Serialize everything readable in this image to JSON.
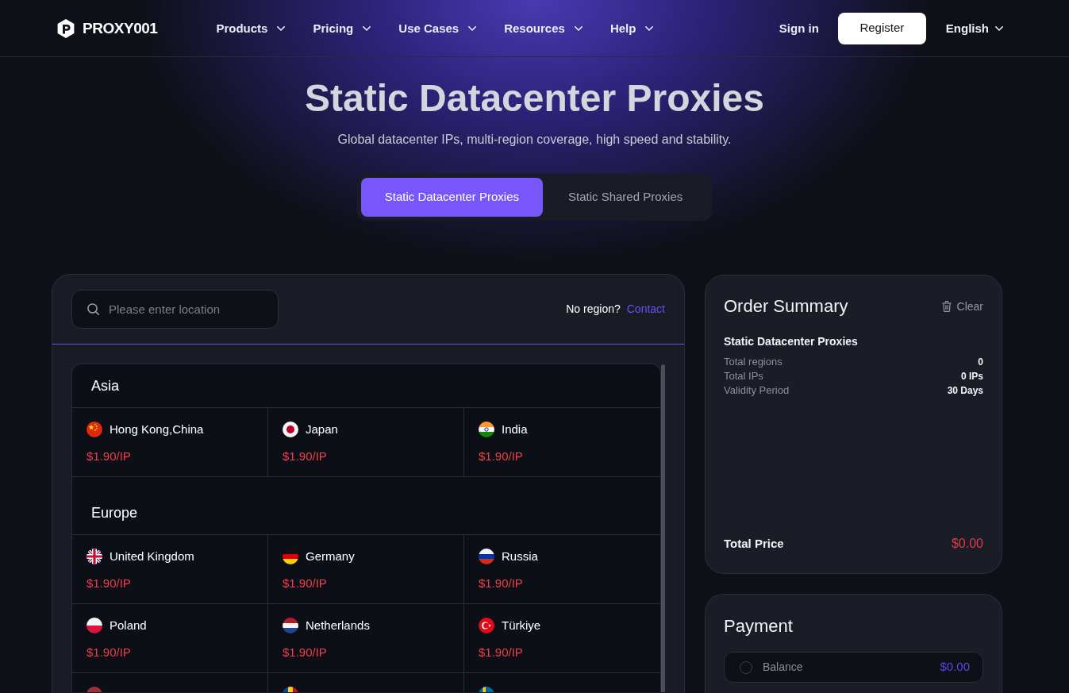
{
  "header": {
    "logo": "PROXY001",
    "nav": [
      {
        "label": "Products"
      },
      {
        "label": "Pricing"
      },
      {
        "label": "Use Cases"
      },
      {
        "label": "Resources"
      },
      {
        "label": "Help"
      }
    ],
    "sign_in": "Sign in",
    "register": "Register",
    "language": "English"
  },
  "hero": {
    "title": "Static Datacenter Proxies",
    "subtitle": "Global datacenter IPs, multi-region coverage, high speed and stability.",
    "tabs": [
      {
        "label": "Static Datacenter Proxies",
        "selected": true
      },
      {
        "label": "Static Shared Proxies",
        "selected": false
      }
    ]
  },
  "locations": {
    "search": {
      "placeholder": "Please enter location"
    },
    "no_region": "No region?",
    "contact": "Contact",
    "regions": [
      {
        "name": "Asia",
        "countries": [
          {
            "name": "Hong Kong,China",
            "kind": "china",
            "price": "$1.90/IP",
            "selected": false
          },
          {
            "name": "Japan",
            "kind": "japan",
            "price": "$1.90/IP",
            "selected": false
          },
          {
            "name": "India",
            "kind": "india",
            "price": "$1.90/IP",
            "selected": false
          }
        ]
      },
      {
        "name": "Europe",
        "countries": [
          {
            "name": "United Kingdom",
            "kind": "uk",
            "price": "$1.90/IP",
            "selected": false
          },
          {
            "name": "Germany",
            "kind": "germany",
            "price": "$1.90/IP",
            "selected": false
          },
          {
            "name": "Russia",
            "kind": "russia",
            "price": "$1.90/IP",
            "selected": false
          },
          {
            "name": "Poland",
            "kind": "poland",
            "price": "$1.90/IP",
            "selected": false
          },
          {
            "name": "Netherlands",
            "kind": "netherlands",
            "price": "$1.90/IP",
            "selected": false
          },
          {
            "name": "Türkiye",
            "kind": "turkey",
            "price": "$1.90/IP",
            "selected": false
          },
          {
            "kind": "latvia",
            "selected": false
          },
          {
            "kind": "moldova",
            "selected": false
          },
          {
            "kind": "sweden",
            "selected": false
          }
        ]
      }
    ]
  },
  "order_summary": {
    "title": "Order Summary",
    "clear": "Clear",
    "product": "Static Datacenter Proxies",
    "rows": [
      {
        "label": "Total regions",
        "value": "0"
      },
      {
        "label": "Total IPs",
        "value": "0 IPs"
      },
      {
        "label": "Validity Period",
        "value": "30 Days"
      }
    ],
    "total_label": "Total Price",
    "total_value": "$0.00"
  },
  "payment": {
    "title": "Payment",
    "options": [
      {
        "label": "Balance",
        "amount": "$0.00",
        "selected": false
      }
    ]
  }
}
